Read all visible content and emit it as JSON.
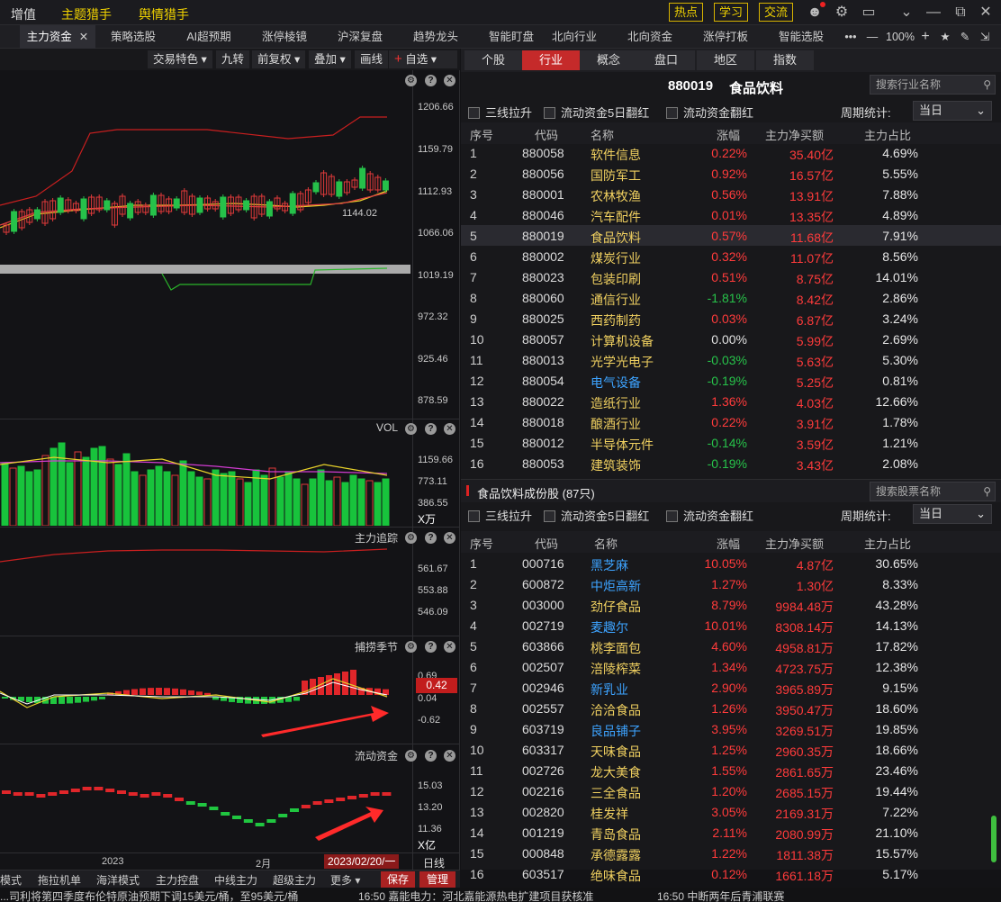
{
  "topbar": {
    "menu": [
      "增值",
      "主题猎手",
      "舆情猎手"
    ],
    "buttons": [
      "热点",
      "学习",
      "交流"
    ]
  },
  "tabs": [
    "主力资金",
    "策略选股",
    "AI超预期",
    "涨停棱镜",
    "沪深复盘",
    "趋势龙头",
    "智能盯盘",
    "北向行业",
    "北向资金",
    "涨停打板",
    "智能选股"
  ],
  "tabbar_zoom": "100%",
  "chart_toolbar": [
    "交易特色",
    "九转",
    "前复权",
    "叠加",
    "画线",
    "自选"
  ],
  "panels": {
    "vol": "VOL",
    "zlzz": "主力追踪",
    "blqj": "捕捞季节",
    "ldzj": "流动资金"
  },
  "bottom_toolbar": [
    "模式",
    "拖拉机单",
    "海洋模式",
    "主力控盘",
    "中线主力",
    "超级主力",
    "更多",
    "保存",
    "管理"
  ],
  "xaxis": {
    "left": "2023",
    "mid": "2月",
    "date": "2023/02/20/一",
    "mode": "日线"
  },
  "right": {
    "tabs": [
      "个股",
      "行业",
      "概念",
      "盘口",
      "地区",
      "指数"
    ],
    "title_code": "880019",
    "title_name": "食品饮料",
    "search_industry": "搜索行业名称",
    "search_stock": "搜索股票名称",
    "filters": [
      "三线拉升",
      "流动资金5日翻红",
      "流动资金翻红"
    ],
    "period_label": "周期统计:",
    "period_value": "当日",
    "headers": [
      "序号",
      "代码",
      "名称",
      "涨幅",
      "主力净买额",
      "主力占比"
    ],
    "sub_title": "食品饮料成份股 (87只)"
  },
  "ticker": [
    "...司利将第四季度布伦特原油预期下调15美元/桶，至95美元/桶",
    "16:50 嘉能电力：河北嘉能源热电扩建项目获核准",
    "16:50 中断两年后青浦联赛"
  ],
  "chart_data": [
    {
      "type": "table",
      "title": "行业资金",
      "columns": [
        "序号",
        "代码",
        "名称",
        "涨幅",
        "主力净买额",
        "主力占比"
      ],
      "rows": [
        [
          "1",
          "880058",
          "软件信息",
          "0.22%",
          "35.40亿",
          "4.69%"
        ],
        [
          "2",
          "880056",
          "国防军工",
          "0.92%",
          "16.57亿",
          "5.55%"
        ],
        [
          "3",
          "880001",
          "农林牧渔",
          "0.56%",
          "13.91亿",
          "7.88%"
        ],
        [
          "4",
          "880046",
          "汽车配件",
          "0.01%",
          "13.35亿",
          "4.89%"
        ],
        [
          "5",
          "880019",
          "食品饮料",
          "0.57%",
          "11.68亿",
          "7.91%"
        ],
        [
          "6",
          "880002",
          "煤炭行业",
          "0.32%",
          "11.07亿",
          "8.56%"
        ],
        [
          "7",
          "880023",
          "包装印刷",
          "0.51%",
          "8.75亿",
          "14.01%"
        ],
        [
          "8",
          "880060",
          "通信行业",
          "-1.81%",
          "8.42亿",
          "2.86%"
        ],
        [
          "9",
          "880025",
          "西药制药",
          "0.03%",
          "6.87亿",
          "3.24%"
        ],
        [
          "10",
          "880057",
          "计算机设备",
          "0.00%",
          "5.99亿",
          "2.69%"
        ],
        [
          "11",
          "880013",
          "光学光电子",
          "-0.03%",
          "5.63亿",
          "5.30%"
        ],
        [
          "12",
          "880054",
          "电气设备",
          "-0.19%",
          "5.25亿",
          "0.81%"
        ],
        [
          "13",
          "880022",
          "造纸行业",
          "1.36%",
          "4.03亿",
          "12.66%"
        ],
        [
          "14",
          "880018",
          "酿酒行业",
          "0.22%",
          "3.91亿",
          "1.78%"
        ],
        [
          "15",
          "880012",
          "半导体元件",
          "-0.14%",
          "3.59亿",
          "1.21%"
        ],
        [
          "16",
          "880053",
          "建筑装饰",
          "-0.19%",
          "3.43亿",
          "2.08%"
        ]
      ]
    },
    {
      "type": "table",
      "title": "食品饮料成份股",
      "columns": [
        "序号",
        "代码",
        "名称",
        "涨幅",
        "主力净买额",
        "主力占比"
      ],
      "rows": [
        [
          "1",
          "000716",
          "黑芝麻",
          "10.05%",
          "4.87亿",
          "30.65%"
        ],
        [
          "2",
          "600872",
          "中炬高新",
          "1.27%",
          "1.30亿",
          "8.33%"
        ],
        [
          "3",
          "003000",
          "劲仔食品",
          "8.79%",
          "9984.48万",
          "43.28%"
        ],
        [
          "4",
          "002719",
          "麦趣尔",
          "10.01%",
          "8308.14万",
          "14.13%"
        ],
        [
          "5",
          "603866",
          "桃李面包",
          "4.60%",
          "4958.81万",
          "17.82%"
        ],
        [
          "6",
          "002507",
          "涪陵榨菜",
          "1.34%",
          "4723.75万",
          "12.38%"
        ],
        [
          "7",
          "002946",
          "新乳业",
          "2.90%",
          "3965.89万",
          "9.15%"
        ],
        [
          "8",
          "002557",
          "洽洽食品",
          "1.26%",
          "3950.47万",
          "18.60%"
        ],
        [
          "9",
          "603719",
          "良品铺子",
          "3.95%",
          "3269.51万",
          "19.85%"
        ],
        [
          "10",
          "603317",
          "天味食品",
          "1.25%",
          "2960.35万",
          "18.66%"
        ],
        [
          "11",
          "002726",
          "龙大美食",
          "1.55%",
          "2861.65万",
          "23.46%"
        ],
        [
          "12",
          "002216",
          "三全食品",
          "1.20%",
          "2685.15万",
          "19.44%"
        ],
        [
          "13",
          "002820",
          "桂发祥",
          "3.05%",
          "2169.31万",
          "7.22%"
        ],
        [
          "14",
          "001219",
          "青岛食品",
          "2.11%",
          "2080.99万",
          "21.10%"
        ],
        [
          "15",
          "000848",
          "承德露露",
          "1.22%",
          "1811.38万",
          "15.57%"
        ],
        [
          "16",
          "603517",
          "绝味食品",
          "0.12%",
          "1661.18万",
          "5.17%"
        ]
      ]
    },
    {
      "type": "line",
      "title": "price",
      "ylim": [
        878.59,
        1206.66
      ],
      "yticks": [
        "1206.66",
        "1159.79",
        "1112.93",
        "1066.06",
        "1019.19",
        "972.32",
        "925.46",
        "878.59"
      ],
      "annotation": "1144.02"
    },
    {
      "type": "bar",
      "title": "VOL",
      "yticks": [
        "1159.66",
        "773.11",
        "386.55"
      ],
      "unit": "X万"
    },
    {
      "type": "line",
      "title": "主力追踪",
      "yticks": [
        "561.67",
        "553.88",
        "546.09"
      ]
    },
    {
      "type": "bar",
      "title": "捕捞季节",
      "yticks": [
        "0.69",
        "0.04",
        "-0.62"
      ],
      "current": "0.42"
    },
    {
      "type": "bar",
      "title": "流动资金",
      "yticks": [
        "15.03",
        "13.20",
        "11.36"
      ],
      "unit": "X亿"
    }
  ]
}
